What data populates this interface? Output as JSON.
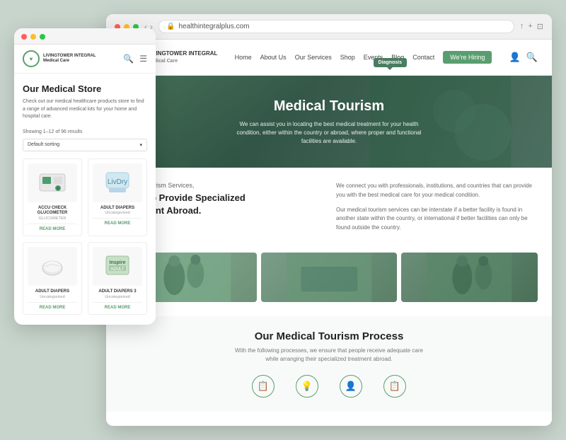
{
  "mobile": {
    "titlebar_dots": [
      "red",
      "yellow",
      "green"
    ],
    "logo_text": "LIVINGTOWER INTEGRAL\nMedical Care",
    "logo_symbol": "♥",
    "store_title": "Our Medical Store",
    "store_desc": "Check out our medical healthcare products store to find a range of advanced medical kits for your home and hospital care.",
    "results_info": "Showing 1–12 of 96 results",
    "sort_label": "Default sorting",
    "products": [
      {
        "name": "ACCU CHECK GLUCOMETER",
        "category": "GLUCOMETER",
        "read_more": "READ MORE",
        "img_type": "glucometer"
      },
      {
        "name": "Adult diapers",
        "category": "Uncategorized",
        "read_more": "READ MORE",
        "img_type": "diapers"
      },
      {
        "name": "ADULT DIAPERS",
        "category": "Uncategorized",
        "read_more": "READ MORE",
        "img_type": "diapers-plain"
      },
      {
        "name": "ADULT DIAPERS 3",
        "category": "Uncategorized",
        "read_more": "READ MORE",
        "img_type": "diapers-box"
      }
    ]
  },
  "browser": {
    "url": "healthintegralplus.com",
    "lock_icon": "🔒",
    "nav_back": "‹",
    "nav_forward": "›"
  },
  "site": {
    "logo_text_line1": "LIVINGTOWER INTEGRAL",
    "logo_text_line2": "Medical Care",
    "logo_symbol": "♥",
    "nav_items": [
      "Home",
      "About Us",
      "Our Services",
      "Shop",
      "Events",
      "Blog",
      "Contact"
    ],
    "nav_cta": "We're Hiring",
    "tooltip_label": "Diagnosis"
  },
  "hero": {
    "title": "Medical Tourism",
    "description": "We can assist you in locating the best medical treatment for your health condition, either within the country or abroad, where proper and functional facilities are available."
  },
  "services": {
    "intro": "Medical Tourism Services,",
    "heading": "We Help Provide Specialized\nTreatment Abroad.",
    "body_1": "We connect you with professionals, institutions, and countries that can provide you with the best medical care for your medical condition.",
    "body_2": "Our medical tourism services can be interstate if a better facility is found in another state within the country, or international if better facilities can only be found outside the country."
  },
  "process": {
    "title": "Our Medical Tourism Process",
    "description": "With the following processes, we ensure that people receive adequate care while arranging their specialized treatment abroad.",
    "icons": [
      "📋",
      "💡",
      "👤",
      "📋"
    ]
  }
}
